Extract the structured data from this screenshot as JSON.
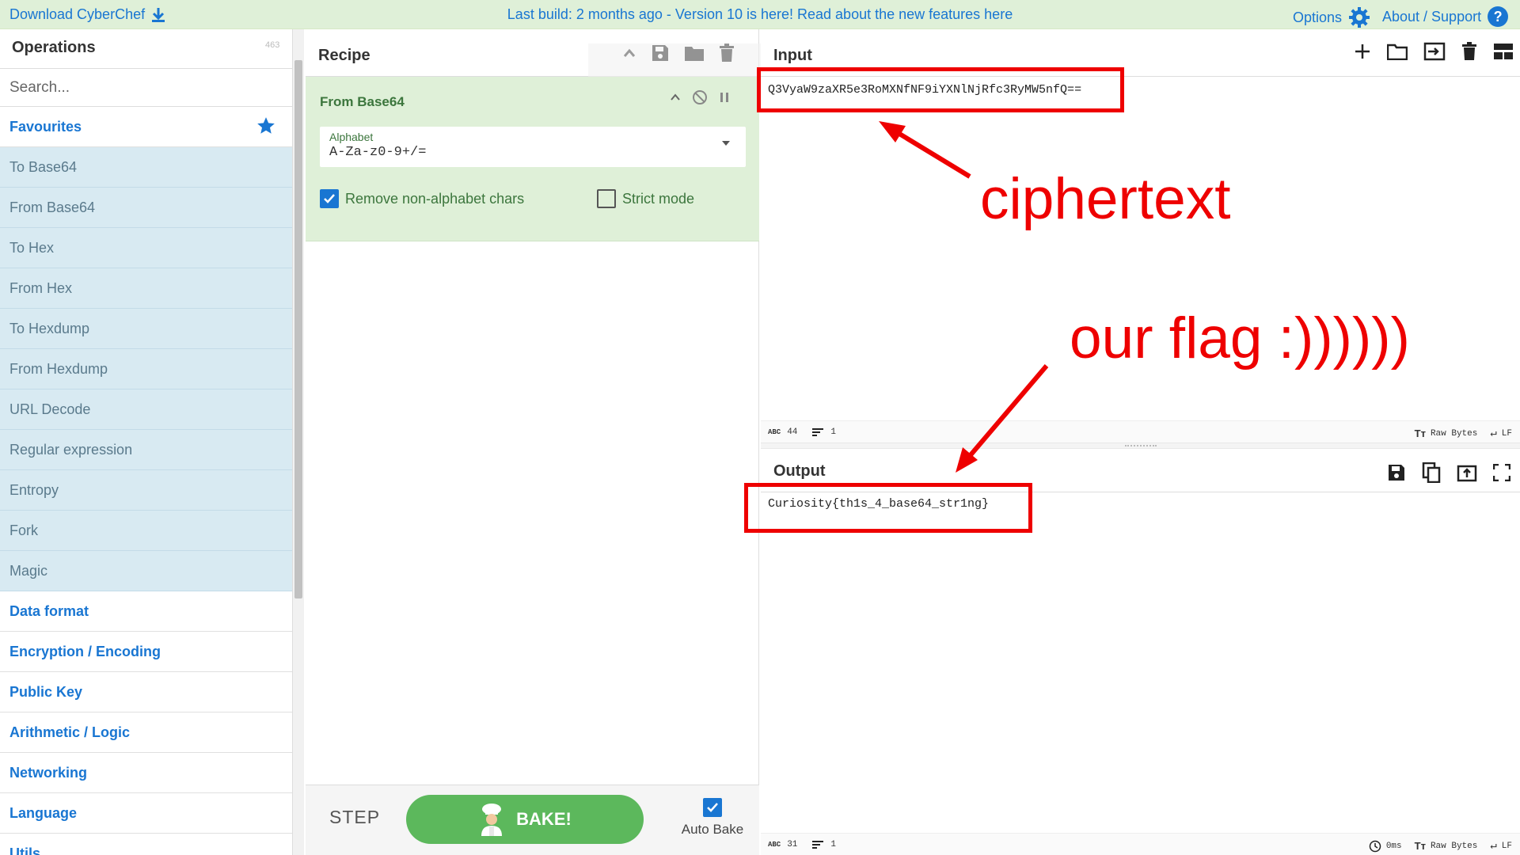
{
  "banner": {
    "download": "Download CyberChef",
    "message": "Last build: 2 months ago - Version 10 is here! Read about the new features here",
    "options": "Options",
    "about": "About / Support"
  },
  "operations": {
    "title": "Operations",
    "count": "463",
    "search_placeholder": "Search...",
    "favourites": "Favourites",
    "items": [
      "To Base64",
      "From Base64",
      "To Hex",
      "From Hex",
      "To Hexdump",
      "From Hexdump",
      "URL Decode",
      "Regular expression",
      "Entropy",
      "Fork",
      "Magic"
    ],
    "categories": [
      "Data format",
      "Encryption / Encoding",
      "Public Key",
      "Arithmetic / Logic",
      "Networking",
      "Language",
      "Utils"
    ]
  },
  "recipe": {
    "title": "Recipe",
    "op_name": "From Base64",
    "alphabet_label": "Alphabet",
    "alphabet_value": "A-Za-z0-9+/=",
    "remove_label": "Remove non-alphabet chars",
    "remove_checked": true,
    "strict_label": "Strict mode",
    "strict_checked": false,
    "step": "STEP",
    "bake": "BAKE!",
    "auto_bake": "Auto Bake",
    "auto_bake_checked": true
  },
  "input": {
    "title": "Input",
    "text": "Q3VyaW9zaXR5e3RoMXNfNF9iYXNlNjRfc3RyMW5nfQ==",
    "length": "44",
    "lines": "1",
    "encoding": "Raw Bytes",
    "eol": "LF"
  },
  "output": {
    "title": "Output",
    "text": "Curiosity{th1s_4_base64_str1ng}",
    "length": "31",
    "lines": "1",
    "time": "0ms",
    "encoding": "Raw Bytes",
    "eol": "LF"
  },
  "annotations": {
    "ciphertext": "ciphertext",
    "flag": "our flag :))))))"
  },
  "colors": {
    "accent": "#1976d2",
    "banner_bg": "#dff0d8",
    "op_bg": "#d8eaf2",
    "bake_green": "#5cb85c",
    "annotation_red": "#ee0000"
  }
}
